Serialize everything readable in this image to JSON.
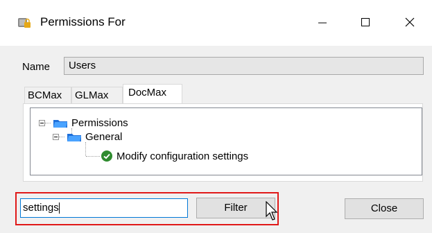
{
  "window": {
    "title": "Permissions For"
  },
  "name": {
    "label": "Name",
    "value": "Users"
  },
  "tabs": [
    {
      "label": "BCMax",
      "active": false
    },
    {
      "label": "GLMax",
      "active": false
    },
    {
      "label": "DocMax",
      "active": true
    }
  ],
  "tree": {
    "root": "Permissions",
    "child": "General",
    "leaf": "Modify configuration settings"
  },
  "filter": {
    "value": "settings",
    "button": "Filter"
  },
  "close_button": "Close",
  "colors": {
    "highlight": "#e01818",
    "check": "#2e8b2e",
    "folder": "#1e6fd9"
  }
}
